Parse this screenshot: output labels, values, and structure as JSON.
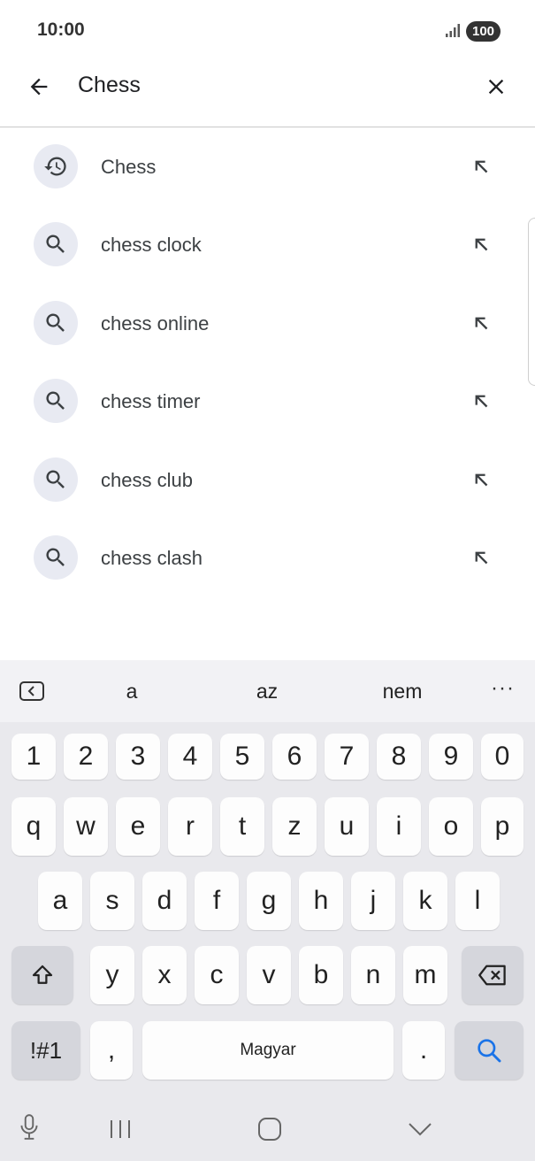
{
  "status": {
    "time": "10:00",
    "battery": "100"
  },
  "search": {
    "query": "Chess"
  },
  "suggestions": [
    {
      "label": "Chess",
      "icon": "history-icon"
    },
    {
      "label": "chess clock",
      "icon": "search-icon"
    },
    {
      "label": "chess online",
      "icon": "search-icon"
    },
    {
      "label": "chess timer",
      "icon": "search-icon"
    },
    {
      "label": "chess club",
      "icon": "search-icon"
    },
    {
      "label": "chess clash",
      "icon": "search-icon"
    }
  ],
  "keyboard": {
    "suggestions": [
      "a",
      "az",
      "nem"
    ],
    "more": "···",
    "row_numbers": [
      "1",
      "2",
      "3",
      "4",
      "5",
      "6",
      "7",
      "8",
      "9",
      "0"
    ],
    "row1": [
      "q",
      "w",
      "e",
      "r",
      "t",
      "z",
      "u",
      "i",
      "o",
      "p"
    ],
    "row2": [
      "a",
      "s",
      "d",
      "f",
      "g",
      "h",
      "j",
      "k",
      "l"
    ],
    "row3": [
      "y",
      "x",
      "c",
      "v",
      "b",
      "n",
      "m"
    ],
    "symbols": "!#1",
    "comma": ",",
    "space": "Magyar",
    "period": "."
  },
  "colors": {
    "accent": "#1a73e8",
    "icon_bg": "#e8eaf2"
  }
}
